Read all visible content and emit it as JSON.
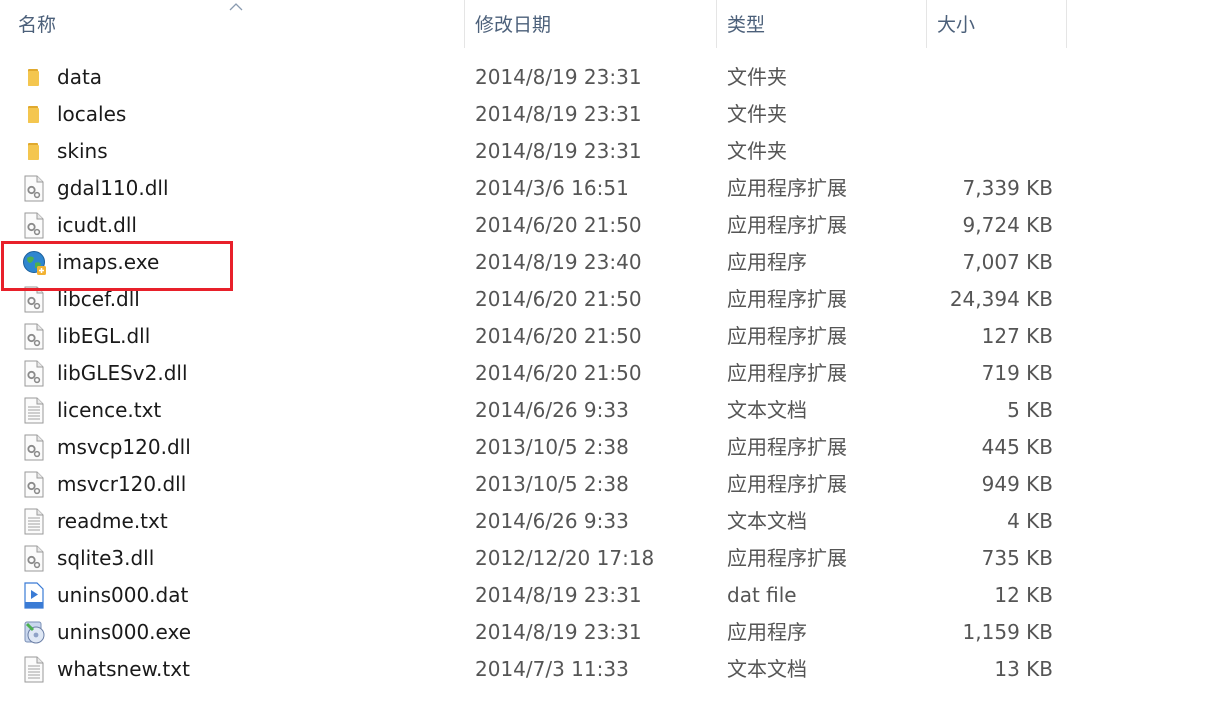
{
  "columns": {
    "name": "名称",
    "date": "修改日期",
    "type": "类型",
    "size": "大小"
  },
  "files": [
    {
      "name": "data",
      "date": "2014/8/19 23:31",
      "type": "文件夹",
      "size": "",
      "icon": "folder-icon"
    },
    {
      "name": "locales",
      "date": "2014/8/19 23:31",
      "type": "文件夹",
      "size": "",
      "icon": "folder-icon"
    },
    {
      "name": "skins",
      "date": "2014/8/19 23:31",
      "type": "文件夹",
      "size": "",
      "icon": "folder-icon"
    },
    {
      "name": "gdal110.dll",
      "date": "2014/3/6 16:51",
      "type": "应用程序扩展",
      "size": "7,339 KB",
      "icon": "dll-icon"
    },
    {
      "name": "icudt.dll",
      "date": "2014/6/20 21:50",
      "type": "应用程序扩展",
      "size": "9,724 KB",
      "icon": "dll-icon"
    },
    {
      "name": "imaps.exe",
      "date": "2014/8/19 23:40",
      "type": "应用程序",
      "size": "7,007 KB",
      "icon": "globe-app-icon",
      "highlighted": true
    },
    {
      "name": "libcef.dll",
      "date": "2014/6/20 21:50",
      "type": "应用程序扩展",
      "size": "24,394 KB",
      "icon": "dll-icon"
    },
    {
      "name": "libEGL.dll",
      "date": "2014/6/20 21:50",
      "type": "应用程序扩展",
      "size": "127 KB",
      "icon": "dll-icon"
    },
    {
      "name": "libGLESv2.dll",
      "date": "2014/6/20 21:50",
      "type": "应用程序扩展",
      "size": "719 KB",
      "icon": "dll-icon"
    },
    {
      "name": "licence.txt",
      "date": "2014/6/26 9:33",
      "type": "文本文档",
      "size": "5 KB",
      "icon": "text-file-icon"
    },
    {
      "name": "msvcp120.dll",
      "date": "2013/10/5 2:38",
      "type": "应用程序扩展",
      "size": "445 KB",
      "icon": "dll-icon"
    },
    {
      "name": "msvcr120.dll",
      "date": "2013/10/5 2:38",
      "type": "应用程序扩展",
      "size": "949 KB",
      "icon": "dll-icon"
    },
    {
      "name": "readme.txt",
      "date": "2014/6/26 9:33",
      "type": "文本文档",
      "size": "4 KB",
      "icon": "text-file-icon"
    },
    {
      "name": "sqlite3.dll",
      "date": "2012/12/20 17:18",
      "type": "应用程序扩展",
      "size": "735 KB",
      "icon": "dll-icon"
    },
    {
      "name": "unins000.dat",
      "date": "2014/8/19 23:31",
      "type": "dat file",
      "size": "12 KB",
      "icon": "video-file-icon"
    },
    {
      "name": "unins000.exe",
      "date": "2014/8/19 23:31",
      "type": "应用程序",
      "size": "1,159 KB",
      "icon": "installer-icon"
    },
    {
      "name": "whatsnew.txt",
      "date": "2014/7/3 11:33",
      "type": "文本文档",
      "size": "13 KB",
      "icon": "text-file-icon"
    }
  ],
  "colors": {
    "header_text": "#4c607a",
    "highlight_border": "#e8202a",
    "folder": "#f4c64f"
  }
}
